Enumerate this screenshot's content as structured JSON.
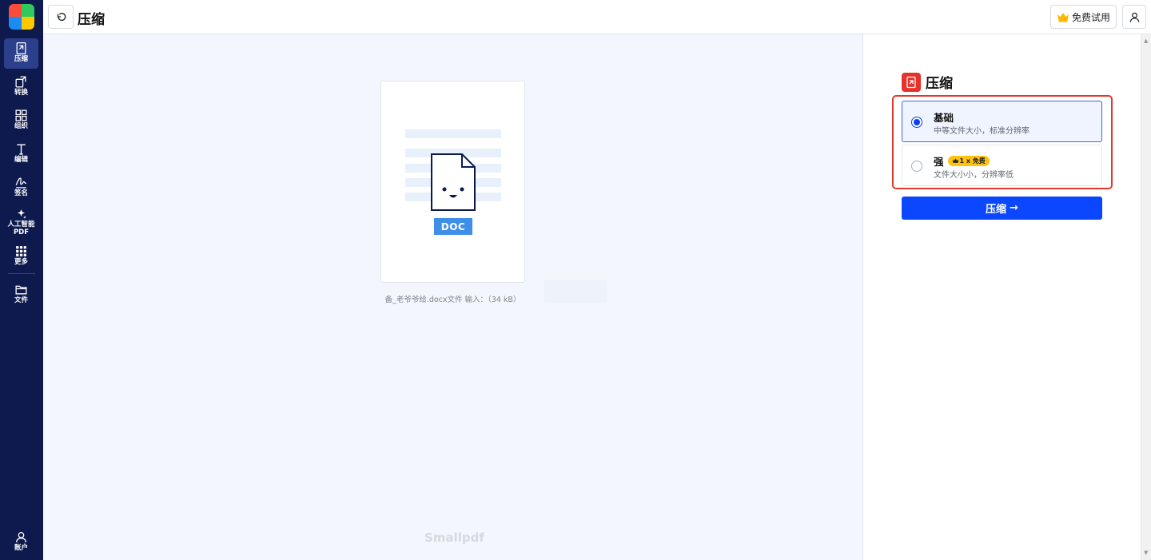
{
  "header": {
    "title": "压缩",
    "trial_label": "免费试用"
  },
  "sidebar": {
    "items": [
      {
        "label": "压缩",
        "icon": "compress-icon"
      },
      {
        "label": "转换",
        "icon": "convert-icon"
      },
      {
        "label": "组织",
        "icon": "organize-icon"
      },
      {
        "label": "编辑",
        "icon": "edit-text-icon"
      },
      {
        "label": "签名",
        "icon": "signature-icon"
      },
      {
        "label": "人工智能",
        "label2": "PDF",
        "icon": "sparkle-icon"
      },
      {
        "label": "更多",
        "icon": "grid-icon"
      },
      {
        "label": "文件",
        "icon": "folder-icon"
      }
    ],
    "account_label": "账户"
  },
  "workspace": {
    "file_type_badge": "DOC",
    "file_caption": "备_老爷爷给.docx文件 输入：（34 kB）",
    "watermark": "Smallpdf"
  },
  "panel": {
    "title": "压缩",
    "options": [
      {
        "title": "基础",
        "desc": "中等文件大小，标准分辨率",
        "selected": true
      },
      {
        "title": "强",
        "badge": "1 x 免费",
        "desc": "文件大小小，分辨率低",
        "selected": false
      }
    ],
    "compress_label": "压缩",
    "compress_arrow": "→"
  },
  "colors": {
    "sidebar_bg": "#0e1a4e",
    "primary_blue": "#0a47ff",
    "brand_red": "#e5322d",
    "highlight_red": "#e03a2f",
    "badge_yellow": "#ffc20e"
  }
}
